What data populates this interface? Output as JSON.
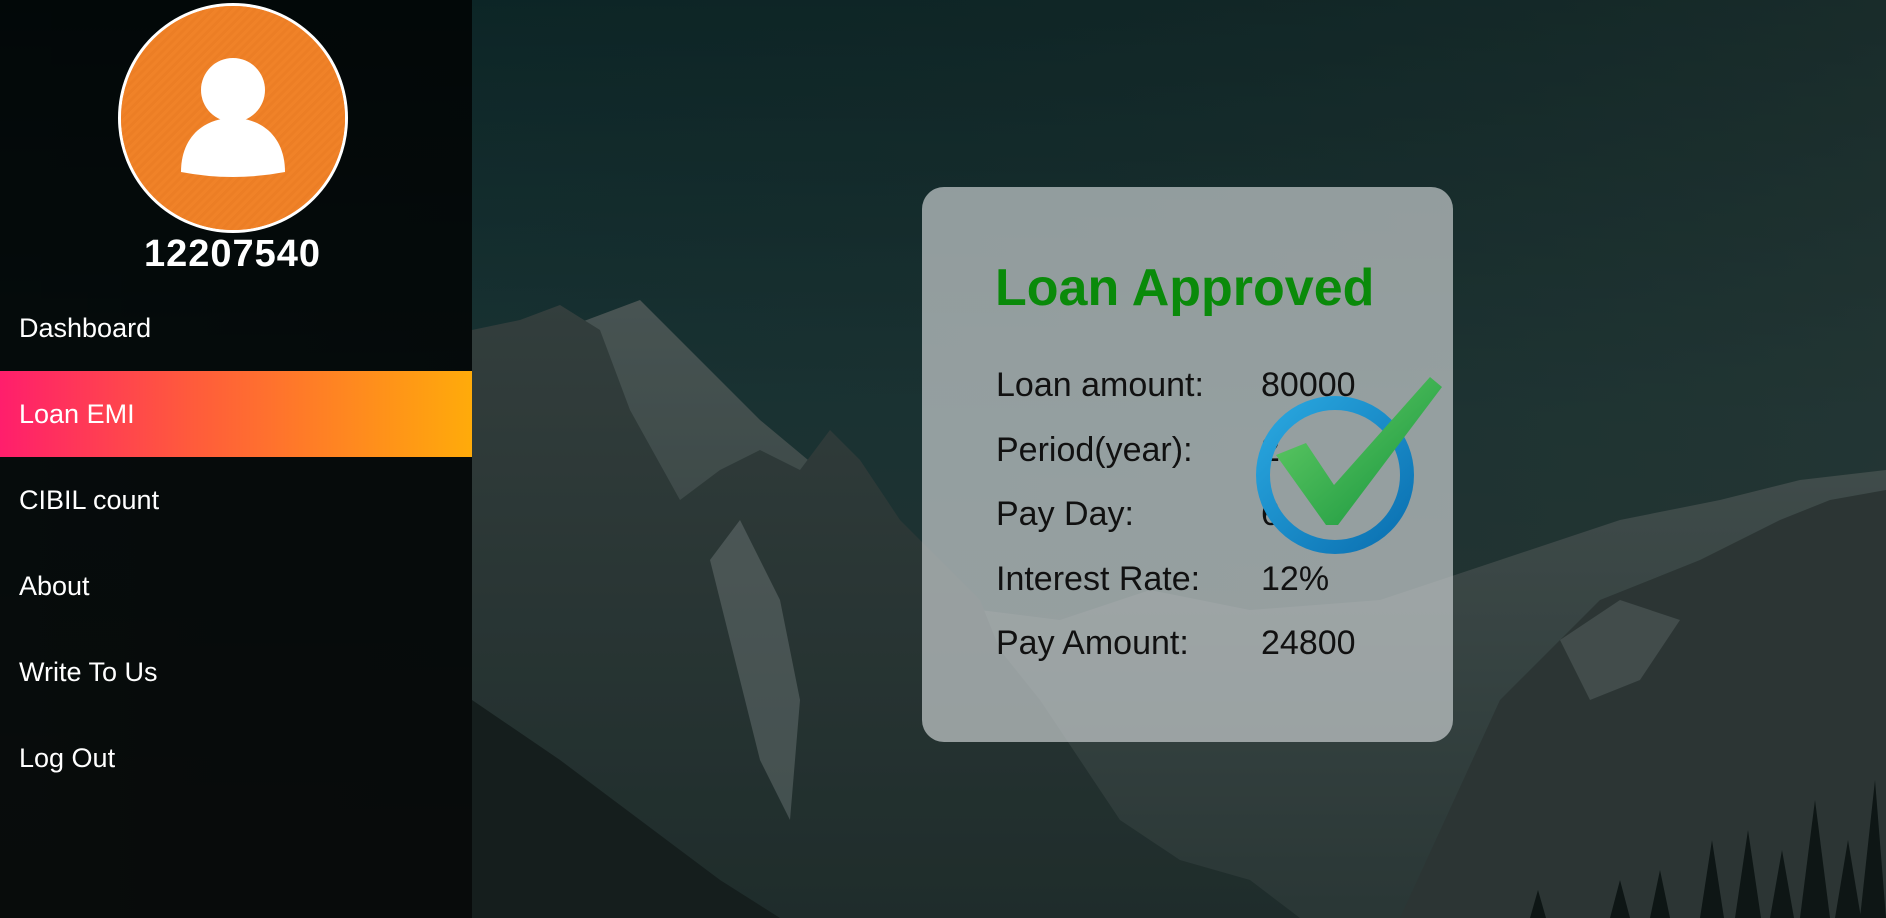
{
  "user": {
    "id": "12207540",
    "avatar_icon": "user-silhouette-icon",
    "avatar_color": "#f08228"
  },
  "sidebar": {
    "items": [
      {
        "label": "Dashboard",
        "active": false
      },
      {
        "label": "Loan EMI",
        "active": true
      },
      {
        "label": "CIBIL count",
        "active": false
      },
      {
        "label": "About",
        "active": false
      },
      {
        "label": "Write To Us",
        "active": false
      },
      {
        "label": "Log Out",
        "active": false
      }
    ],
    "active_gradient": [
      "#ff1e6c",
      "#ffab0a"
    ]
  },
  "loan": {
    "title": "Loan Approved",
    "title_color": "#0a8a0a",
    "status_icon": "approved-checkmark-icon",
    "rows": [
      {
        "label": "Loan amount:",
        "value": "80000"
      },
      {
        "label": "Period(year):",
        "value": "2"
      },
      {
        "label": "Pay Day:",
        "value": "6"
      },
      {
        "label": "Interest Rate:",
        "value": "12%"
      },
      {
        "label": "Pay Amount:",
        "value": "24800"
      }
    ]
  },
  "background": {
    "image": "mountain-landscape",
    "tint": "#1a3a3c"
  }
}
